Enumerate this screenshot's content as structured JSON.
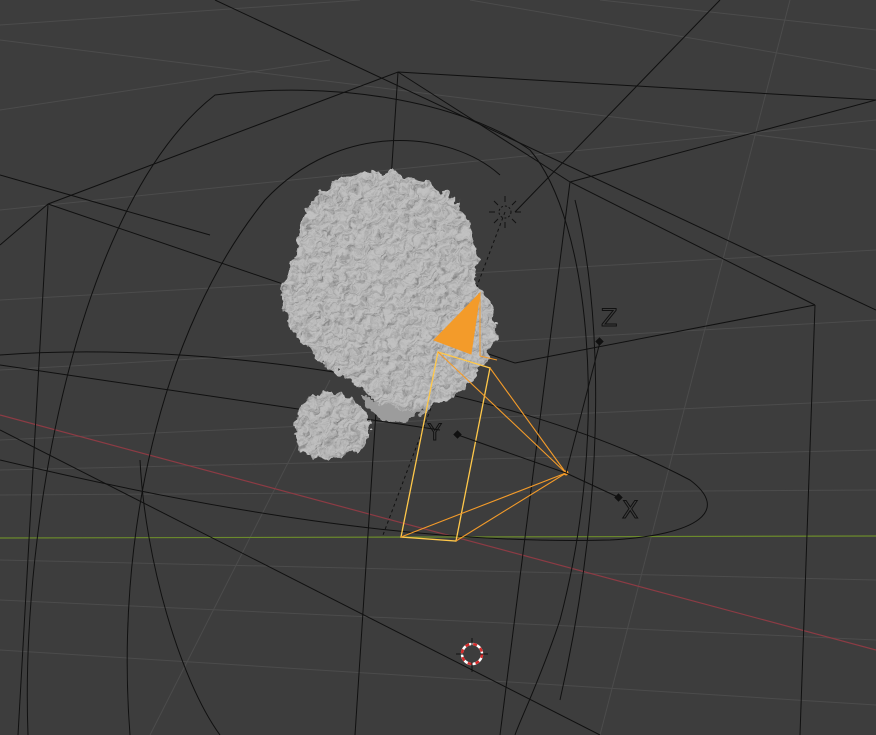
{
  "viewport": {
    "background_color": "#3d3d3d",
    "grid_color": "#505050",
    "x_axis_color": "#8c3b44",
    "y_axis_color": "#6b8a2c",
    "wire_color": "#101010",
    "selection_color": "#f39b2a",
    "selection_active_color": "#ffc84a",
    "mesh_color": "#b4b4b4"
  },
  "objects": {
    "mesh": "asteroid-rock-mesh",
    "camera": "camera-object",
    "light": "sun-lamp",
    "cursor": "3d-cursor"
  },
  "empty_axes": {
    "x_label": "X",
    "y_label": "Y",
    "z_label": "Z"
  }
}
